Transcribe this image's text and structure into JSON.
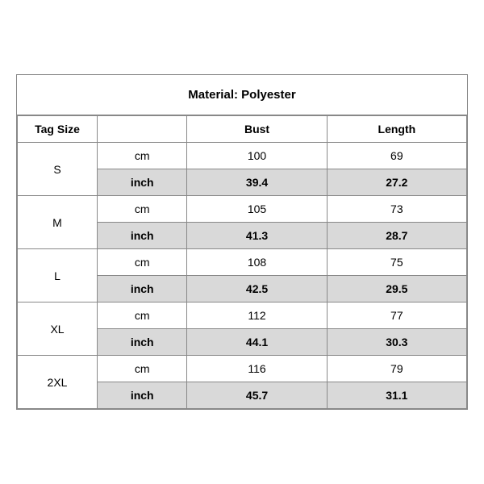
{
  "title": "Material: Polyester",
  "columns": {
    "tag_size": "Tag Size",
    "bust": "Bust",
    "length": "Length"
  },
  "sizes": [
    {
      "tag": "S",
      "cm_bust": "100",
      "cm_length": "69",
      "inch_bust": "39.4",
      "inch_length": "27.2"
    },
    {
      "tag": "M",
      "cm_bust": "105",
      "cm_length": "73",
      "inch_bust": "41.3",
      "inch_length": "28.7"
    },
    {
      "tag": "L",
      "cm_bust": "108",
      "cm_length": "75",
      "inch_bust": "42.5",
      "inch_length": "29.5"
    },
    {
      "tag": "XL",
      "cm_bust": "112",
      "cm_length": "77",
      "inch_bust": "44.1",
      "inch_length": "30.3"
    },
    {
      "tag": "2XL",
      "cm_bust": "116",
      "cm_length": "79",
      "inch_bust": "45.7",
      "inch_length": "31.1"
    }
  ],
  "units": {
    "cm": "cm",
    "inch": "inch"
  }
}
